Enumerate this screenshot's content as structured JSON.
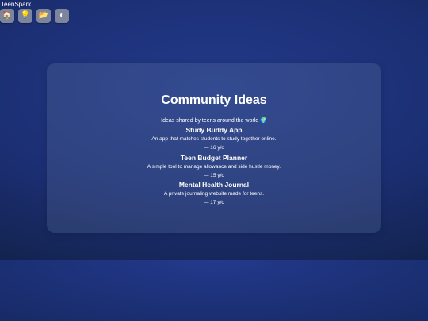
{
  "brand": "TeenSpark",
  "nav": [
    {
      "icon": "home-icon",
      "glyph": "🏠"
    },
    {
      "icon": "lightbulb-icon",
      "glyph": "💡"
    },
    {
      "icon": "folder-icon",
      "glyph": "📂"
    },
    {
      "icon": "theme-toggle-icon",
      "glyph": "◐"
    }
  ],
  "card": {
    "title": "Community Ideas",
    "subtitle": "Ideas shared by teens around the world 🌍",
    "ideas": [
      {
        "title": "Study Buddy App",
        "description": "An app that matches students to study together online.",
        "age": "— 16 y/o"
      },
      {
        "title": "Teen Budget Planner",
        "description": "A simple tool to manage allowance and side hustle money.",
        "age": "— 15 y/o"
      },
      {
        "title": "Mental Health Journal",
        "description": "A private journaling website made for teens.",
        "age": "— 17 y/o"
      }
    ]
  },
  "colors": {
    "background": "#1c2f74",
    "card": "#3a4a72",
    "nav_button": "#7c859c"
  }
}
